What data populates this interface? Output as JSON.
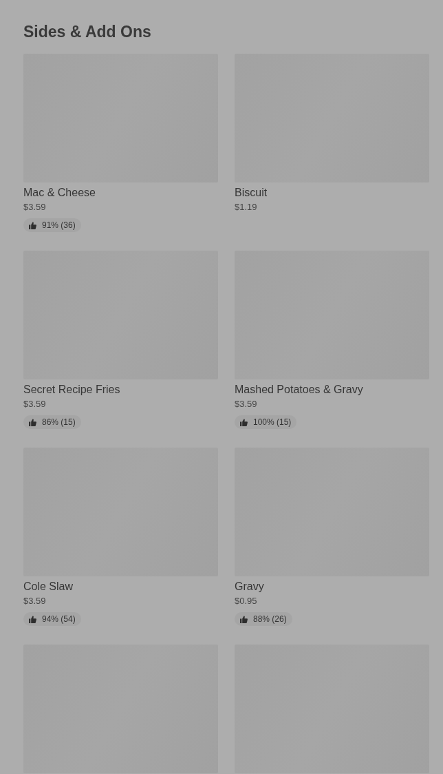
{
  "section": {
    "title": "Sides & Add Ons"
  },
  "items": [
    {
      "kind": "full",
      "name": "Mac & Cheese",
      "price": "$3.59",
      "rating": "91% (36)"
    },
    {
      "kind": "full",
      "name": "Biscuit",
      "price": "$1.19"
    },
    {
      "kind": "full",
      "name": "Secret Recipe Fries",
      "price": "$3.59",
      "rating": "86% (15)"
    },
    {
      "kind": "full",
      "name": "Mashed Potatoes & Gravy",
      "price": "$3.59",
      "rating": "100% (15)"
    },
    {
      "kind": "full",
      "name": "Cole Slaw",
      "price": "$3.59",
      "rating": "94% (54)"
    },
    {
      "kind": "full",
      "name": "Gravy",
      "price": "$0.95",
      "rating": "88% (26)"
    },
    {
      "kind": "image-only"
    },
    {
      "kind": "image-only"
    }
  ]
}
